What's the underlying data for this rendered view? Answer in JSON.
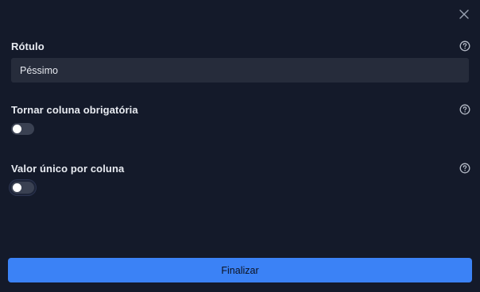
{
  "dialog": {
    "close_icon": "close-icon"
  },
  "fields": {
    "label": {
      "title": "Rótulo",
      "value": "Péssimo",
      "help_icon": "help-circle-icon"
    },
    "required": {
      "title": "Tornar coluna obrigatória",
      "enabled": false,
      "help_icon": "help-circle-icon"
    },
    "unique": {
      "title": "Valor único por coluna",
      "enabled": false,
      "help_icon": "help-circle-icon"
    }
  },
  "footer": {
    "submit_label": "Finalizar"
  },
  "colors": {
    "background": "#141a2a",
    "input_background": "#262c3b",
    "primary": "#3b82f6",
    "toggle_off": "#3a4152"
  }
}
